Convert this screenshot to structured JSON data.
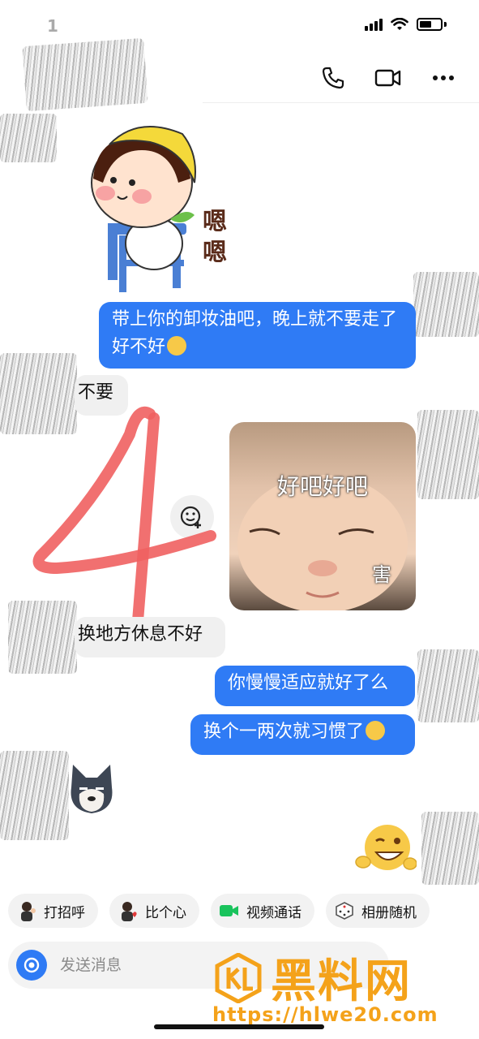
{
  "status_bar": {
    "time": "1"
  },
  "header": {
    "actions": [
      "phone-icon",
      "video-icon",
      "more-icon"
    ]
  },
  "stickers": {
    "girl_caption": "嗯嗯",
    "baby_caption_main": "好吧好吧",
    "baby_caption_sub": "害"
  },
  "messages": [
    {
      "side": "sent",
      "text": "带上你的卸妆油吧，晚上就不要走了好不好",
      "emoji": "smirk-emoji"
    },
    {
      "side": "received",
      "text": "不要"
    },
    {
      "side": "received",
      "text": "换地方休息不好"
    },
    {
      "side": "sent",
      "text": "你慢慢适应就好了么"
    },
    {
      "side": "sent",
      "text": "换个一两次就习惯了",
      "emoji": "grin-emoji"
    }
  ],
  "overlay": {
    "drawn_number": "4"
  },
  "quick_replies": [
    {
      "label": "打招呼",
      "icon": "wave-avatar-icon"
    },
    {
      "label": "比个心",
      "icon": "heart-avatar-icon"
    },
    {
      "label": "视频通话",
      "icon": "video-call-icon"
    },
    {
      "label": "相册随机",
      "icon": "dice-icon"
    }
  ],
  "input": {
    "placeholder": "发送消息"
  },
  "watermark": {
    "brand": "黑料网",
    "url": "https://hlwe20.com"
  },
  "colors": {
    "sent_bubble": "#2f7bf5",
    "received_bubble": "#f0f0f0",
    "watermark": "#f4a21a",
    "drawn_4": "#f06060"
  }
}
